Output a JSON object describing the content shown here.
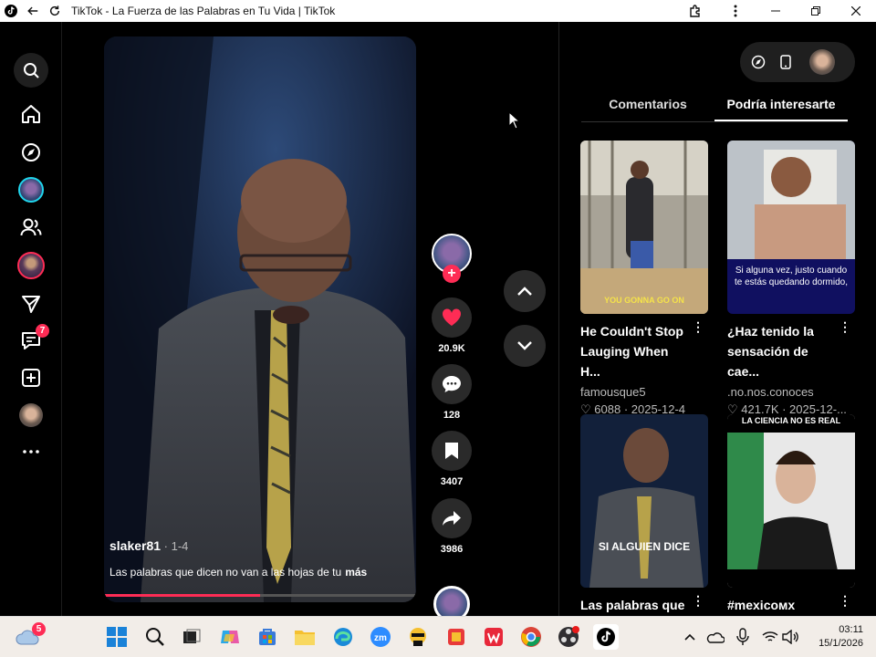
{
  "window": {
    "title": "TikTok - La Fuerza de las Palabras en Tu Vida | TikTok"
  },
  "nav": {
    "notifications_badge": "7"
  },
  "video": {
    "username": "slaker81",
    "date": " · 1-4",
    "description": "Las palabras que dicen no van a las hojas de tu",
    "more_label": "más",
    "progress": 0.5
  },
  "actions": {
    "likes": "20.9K",
    "comments": "128",
    "saves": "3407",
    "shares": "3986"
  },
  "panel": {
    "tabs": [
      "Comentarios",
      "Podría interesarte"
    ],
    "cards": [
      {
        "title": "He Couldn't Stop Lauging When H...",
        "author": "famousque5",
        "likes": "6088",
        "date": "2025-12-4",
        "overlay_text": "YOU GONNA GO ON"
      },
      {
        "title": "¿Haz tenido la sensación de cae...",
        "author": ".no.nos.conoces",
        "likes": "421.7K",
        "date": "2025-12-...",
        "overlay_text": "Si alguna vez, justo cuando te estás quedando dormido,"
      },
      {
        "title": "Las palabras que",
        "overlay_text": "SI ALGUIEN DICE"
      },
      {
        "title": "#mexicoᴍx",
        "overlay_text": "LA CIENCIA NO ES REAL"
      }
    ]
  },
  "taskbar": {
    "weather_badge": "5",
    "time": "03:11",
    "date": "15/1/2026"
  }
}
